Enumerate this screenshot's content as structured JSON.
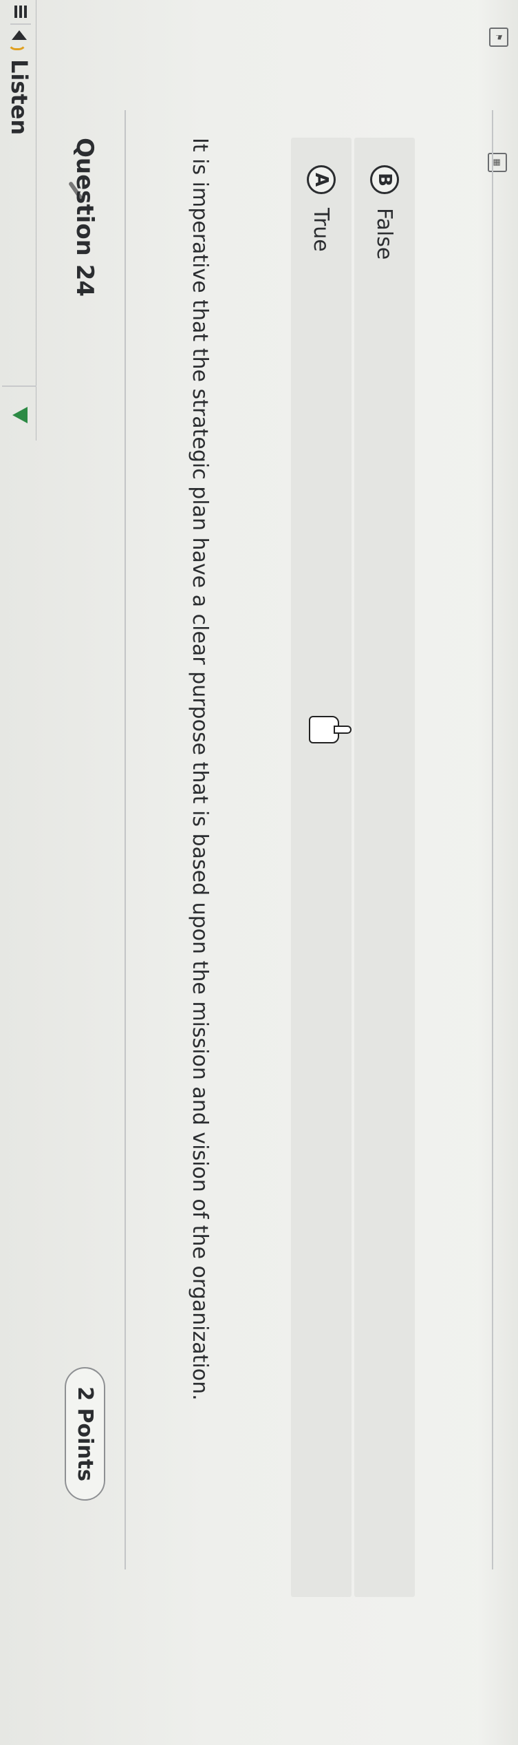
{
  "toolbar": {
    "listen_label": "Listen"
  },
  "question": {
    "title": "Question 24",
    "points": "2 Points",
    "text": "It is imperative that the strategic plan have a clear purpose that is based upon the mission and vision of the organization.",
    "options": [
      {
        "letter": "A",
        "label": "True"
      },
      {
        "letter": "B",
        "label": "False"
      }
    ]
  },
  "icons": {
    "flag": "flag-icon",
    "calculator": "calculator-icon",
    "pen": "pen-icon",
    "menu": "hamburger-icon",
    "speaker": "speaker-icon",
    "play": "play-icon",
    "cursor": "hand-cursor-icon"
  },
  "colors": {
    "play_accent": "#2c8a44",
    "speaker_wave": "#e0a020"
  }
}
